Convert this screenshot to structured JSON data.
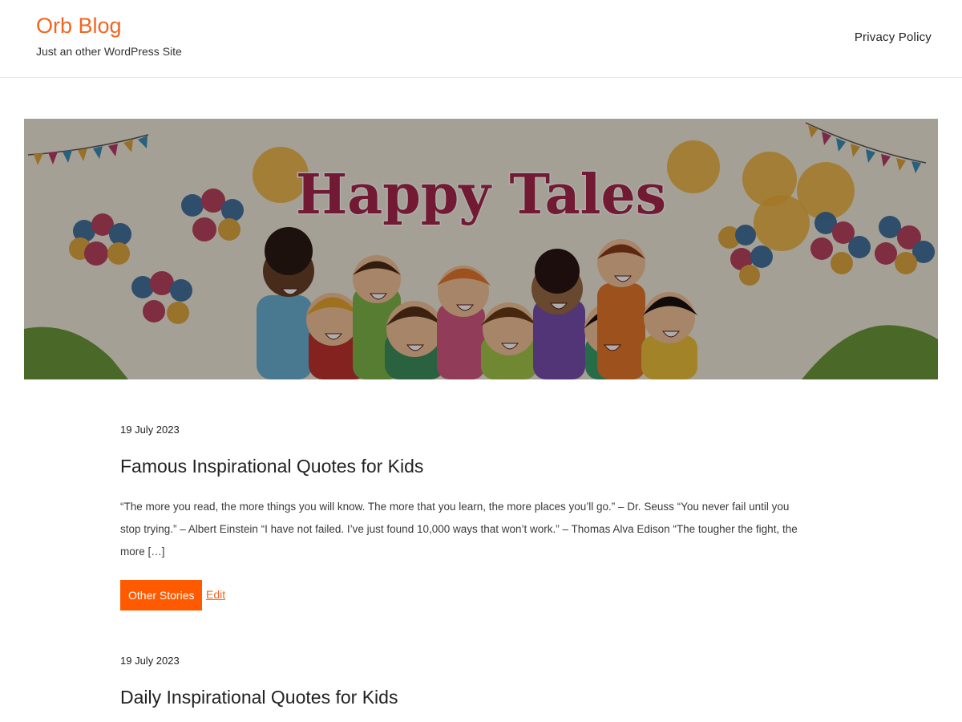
{
  "header": {
    "site_title": "Orb Blog",
    "tagline": "Just an other WordPress Site",
    "nav": [
      {
        "label": "Privacy Policy"
      }
    ]
  },
  "banner": {
    "title_text": "Happy Tales",
    "title_color": "#a8254c"
  },
  "posts": [
    {
      "date": "19 July 2023",
      "title": "Famous Inspirational Quotes for Kids",
      "excerpt": "“The more you read, the more things you will know. The more that you learn, the more places you’ll go.” – Dr. Seuss “You never fail until you stop trying.” – Albert Einstein “I have not failed. I’ve just found 10,000 ways that won’t work.” – Thomas Alva Edison “The tougher the fight, the more […]",
      "category_label": "Other Stories",
      "edit_label": "Edit"
    },
    {
      "date": "19 July 2023",
      "title": "Daily Inspirational Quotes for Kids"
    }
  ],
  "colors": {
    "accent": "#f26522",
    "button": "#ff5a00"
  }
}
